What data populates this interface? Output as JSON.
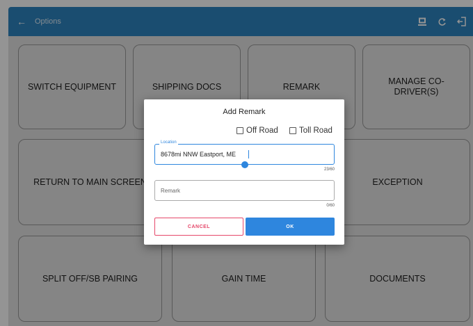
{
  "appbar": {
    "title": "Options",
    "back_icon": "arrow-left-icon",
    "actions": [
      "sync-device-icon",
      "refresh-icon",
      "logout-icon"
    ]
  },
  "tiles": [
    {
      "label": "SWITCH EQUIPMENT"
    },
    {
      "label": "SHIPPING DOCS"
    },
    {
      "label": "REMARK"
    },
    {
      "label": "MANAGE CO-DRIVER(S)"
    },
    {
      "label": "RETURN TO MAIN SCREEN"
    },
    {
      "label": "EXCEPTION"
    },
    {
      "label": "SPLIT OFF/SB PAIRING"
    },
    {
      "label": "GAIN TIME"
    },
    {
      "label": "DOCUMENTS"
    }
  ],
  "dialog": {
    "title": "Add Remark",
    "off_road": "Off Road",
    "toll_road": "Toll Road",
    "location_label": "Location",
    "location_value": "8678mi NNW Eastport, ME",
    "location_count": "23/60",
    "remark_placeholder": "Remark",
    "remark_count": "0/60",
    "cancel": "CANCEL",
    "ok": "OK"
  },
  "colors": {
    "appbar": "#2e86c1",
    "accent": "#2e86de",
    "cancel": "#e5486a"
  }
}
